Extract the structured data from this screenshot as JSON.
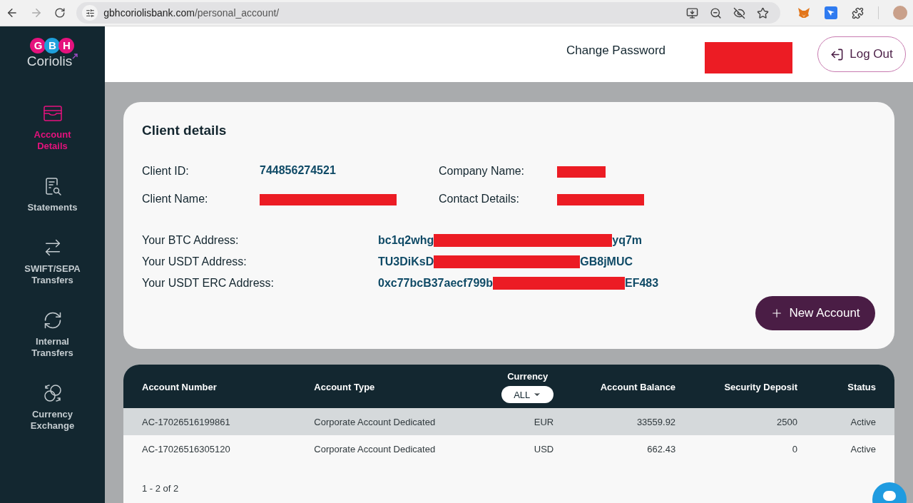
{
  "browser": {
    "url_host": "gbhcoriolisbank.com",
    "url_path": "/personal_account/"
  },
  "logo": {
    "badge": [
      "G",
      "B",
      "H"
    ],
    "name": "Coriolis"
  },
  "sidebar": {
    "items": [
      {
        "label": "Account Details",
        "kind": "wallet",
        "selected": true
      },
      {
        "label": "Statements",
        "kind": "statement",
        "selected": false
      },
      {
        "label": "SWIFT/SEPA Transfers",
        "kind": "swap",
        "selected": false
      },
      {
        "label": "Internal Transfers",
        "kind": "cycle",
        "selected": false
      },
      {
        "label": "Currency Exchange",
        "kind": "exchange",
        "selected": false
      }
    ]
  },
  "header": {
    "change_password": "Change Password",
    "user_redacted": true,
    "logout": "Log Out"
  },
  "client_details": {
    "title": "Client details",
    "fields": [
      {
        "label": "Client ID:",
        "value": "744856274521",
        "redacted": false
      },
      {
        "label": "Company Name:",
        "redacted": true
      },
      {
        "label": "Client Name:",
        "redacted": true
      },
      {
        "label": "Contact Details:",
        "redacted": true
      }
    ],
    "addresses": [
      {
        "label": "Your BTC Address:",
        "prefix": "bc1q2whg",
        "suffix": "yq7m"
      },
      {
        "label": "Your USDT Address:",
        "prefix": "TU3DiKsD",
        "suffix": "GB8jMUC"
      },
      {
        "label": "Your USDT ERC Address:",
        "prefix": "0xc77bcB37aecf799b",
        "suffix": "EF483"
      }
    ],
    "new_account": "New Account"
  },
  "table": {
    "columns": [
      "Account Number",
      "Account Type",
      "Currency",
      "Account Balance",
      "Security Deposit",
      "Status"
    ],
    "currency_filter": "ALL",
    "rows": [
      {
        "cells": [
          "AC-17026516199861",
          "Corporate Account Dedicated",
          "EUR",
          "33559.92",
          "2500",
          "Active"
        ],
        "selected": true
      },
      {
        "cells": [
          "AC-17026516305120",
          "Corporate Account Dedicated",
          "USD",
          "662.43",
          "0",
          "Active"
        ],
        "selected": false
      }
    ],
    "pagination": "1 - 2 of 2"
  }
}
